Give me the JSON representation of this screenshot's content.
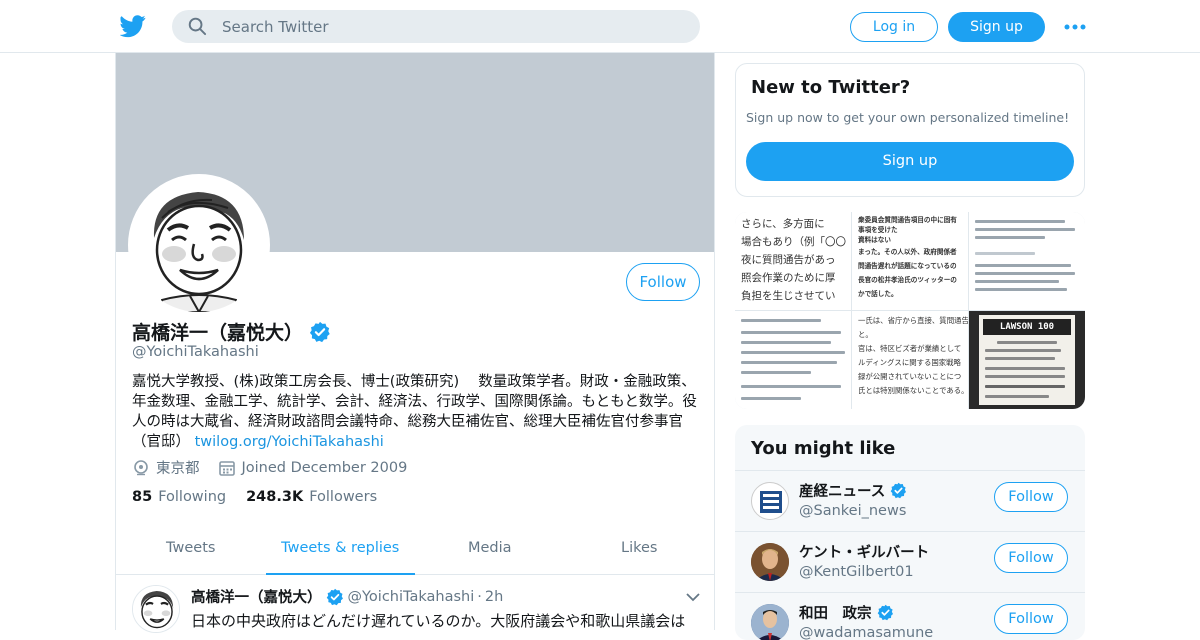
{
  "header": {
    "logo_icon": "twitter-bird-icon",
    "search_placeholder": "Search Twitter",
    "login_label": "Log in",
    "signup_label": "Sign up",
    "more_icon": "more-dots-icon",
    "accent_color": "#1da1f2"
  },
  "profile": {
    "name": "高橋洋一（嘉悦大）",
    "handle": "@YoichiTakahashi",
    "follow_label": "Follow",
    "bio_text": "嘉悦大学教授、(株)政策工房会長、博士(政策研究)　 数量政策学者。財政・金融政策、年金数理、金融工学、統計学、会計、経済法、行政学、国際関係論。もともと数学。役人の時は大蔵省、経済財政諮問会議特命、総務大臣補佐官、総理大臣補佐官付参事官（官邸）",
    "bio_link": "twilog.org/YoichiTakahashi",
    "location": "東京都",
    "joined": "Joined December 2009",
    "following_count": "85",
    "following_label": "Following",
    "followers_count": "248.3K",
    "followers_label": "Followers",
    "banner_color": "#c2cbd3"
  },
  "tabs": [
    {
      "label": "Tweets",
      "active": false
    },
    {
      "label": "Tweets & replies",
      "active": true
    },
    {
      "label": "Media",
      "active": false
    },
    {
      "label": "Likes",
      "active": false
    }
  ],
  "tweet": {
    "name": "高橋洋一（嘉悦大）",
    "handle": "@YoichiTakahashi",
    "dot": "·",
    "time": "2h",
    "text": "日本の中央政府はどんだけ遅れているのか。大阪府議会や和歌山県議会は"
  },
  "new_to_twitter": {
    "title": "New to Twitter?",
    "subtitle": "Sign up now to get your own personalized timeline!",
    "signup_label": "Sign up"
  },
  "media_grid": {
    "doc_lines": [
      "さらに、多方面に",
      "場合もあり（例「〇〇",
      "夜に質問通告があっ",
      "照会作業のために厚",
      "負担を生じさせてい"
    ],
    "doc2_lines": [
      "衆委員会質問通告項目の中に固有",
      "事項を受けた",
      "資料はない",
      "まった。その人以外、政府関係者",
      "問通告遅れが話題になっているの",
      "長官の松井孝治氏のツィッターの",
      "かで話した。"
    ],
    "receipt_brand": "LAWSON 100",
    "tweet_snippet_lines": [
      "一氏は、省庁から直接、質問通告",
      "と。",
      "官は、特区ビズ者が業績として",
      "ルディングスに関する国家戦略",
      "録が公開されていないことにつ",
      "氏とは特別関係ないことである。"
    ]
  },
  "you_might_like": {
    "title": "You might like",
    "accounts": [
      {
        "name": "産経ニュース",
        "handle": "@Sankei_news",
        "follow_label": "Follow",
        "verified": true
      },
      {
        "name": "ケント・ギルバート",
        "handle": "@KentGilbert01",
        "follow_label": "Follow",
        "verified": true
      },
      {
        "name": "和田　政宗",
        "handle": "@wadamasamune",
        "follow_label": "Follow",
        "verified": true
      }
    ]
  }
}
